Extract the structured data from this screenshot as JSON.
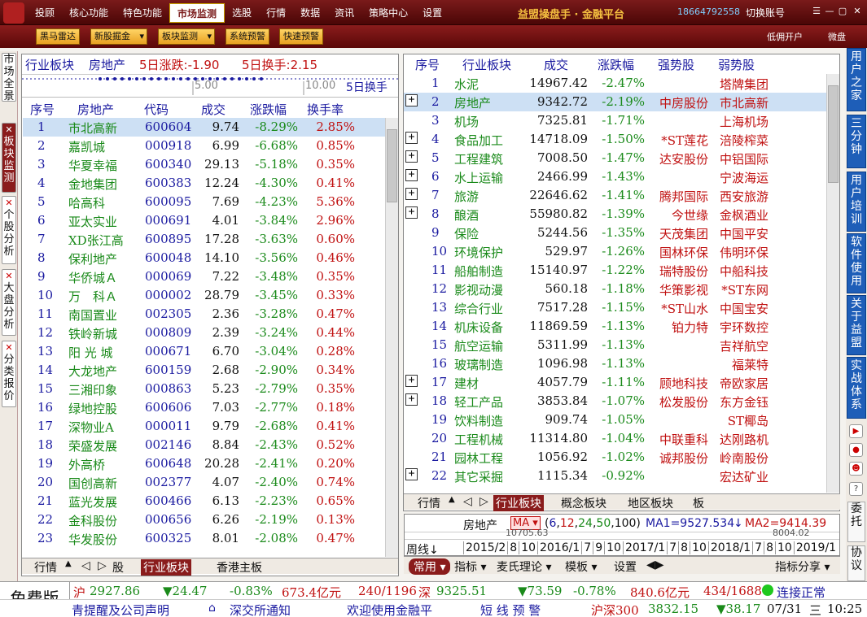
{
  "topbar": {
    "menu": [
      "投顾",
      "核心功能",
      "特色功能",
      "市场监测",
      "选股",
      "行情",
      "数据",
      "资讯",
      "策略中心",
      "设置"
    ],
    "active_menu": "市场监测",
    "app_title": "益盟操盘手 · 金融平台",
    "phone": "18664792558",
    "switch_account": "切换账号"
  },
  "toolbar": {
    "buttons": [
      "黑马雷达",
      "新股掘金",
      "板块监测",
      "系统预警",
      "快速预警"
    ],
    "dropdown_buttons": [
      "新股掘金",
      "板块监测"
    ],
    "right_links": [
      "低佣开户",
      "微盘"
    ]
  },
  "left_tabs": [
    {
      "label": "市场全景",
      "closable": false
    },
    {
      "label": "板块监测",
      "closable": true,
      "active": true
    },
    {
      "label": "个股分析",
      "closable": true
    },
    {
      "label": "大盘分析",
      "closable": true
    },
    {
      "label": "分类报价",
      "closable": true
    }
  ],
  "right_tabs": [
    "用户之家",
    "三分钟",
    "用户培训",
    "软件使用",
    "关于益盟",
    "实战体系"
  ],
  "right_text_buttons": [
    "委托",
    "协议"
  ],
  "left_panel": {
    "header": {
      "industry": "行业板块",
      "sector": "房地产",
      "rise5d": "5日涨跌:-1.90",
      "turnover5d": "5日换手:2.15"
    },
    "mini_chart": {
      "tick1": "5.00",
      "tick2": "10.00",
      "label": "5日换手"
    },
    "columns": [
      "序号",
      "房地产",
      "代码",
      "成交",
      "涨跌幅",
      "换手率"
    ],
    "rows": [
      [
        "1",
        "市北高新",
        "600604",
        "9.74",
        "-8.29%",
        "2.85%"
      ],
      [
        "2",
        "嘉凯城",
        "000918",
        "6.99",
        "-6.68%",
        "0.85%"
      ],
      [
        "3",
        "华夏幸福",
        "600340",
        "29.13",
        "-5.18%",
        "0.35%"
      ],
      [
        "4",
        "金地集团",
        "600383",
        "12.24",
        "-4.30%",
        "0.41%"
      ],
      [
        "5",
        "哈高科",
        "600095",
        "7.69",
        "-4.23%",
        "5.36%"
      ],
      [
        "6",
        "亚太实业",
        "000691",
        "4.01",
        "-3.84%",
        "2.96%"
      ],
      [
        "7",
        "XD张江高",
        "600895",
        "17.28",
        "-3.63%",
        "0.60%"
      ],
      [
        "8",
        "保利地产",
        "600048",
        "14.10",
        "-3.56%",
        "0.46%"
      ],
      [
        "9",
        "华侨城Ａ",
        "000069",
        "7.22",
        "-3.48%",
        "0.35%"
      ],
      [
        "10",
        "万　科Ａ",
        "000002",
        "28.79",
        "-3.45%",
        "0.33%"
      ],
      [
        "11",
        "南国置业",
        "002305",
        "2.36",
        "-3.28%",
        "0.47%"
      ],
      [
        "12",
        "铁岭新城",
        "000809",
        "2.39",
        "-3.24%",
        "0.44%"
      ],
      [
        "13",
        "阳 光 城",
        "000671",
        "6.70",
        "-3.04%",
        "0.28%"
      ],
      [
        "14",
        "大龙地产",
        "600159",
        "2.68",
        "-2.90%",
        "0.34%"
      ],
      [
        "15",
        "三湘印象",
        "000863",
        "5.23",
        "-2.79%",
        "0.35%"
      ],
      [
        "16",
        "绿地控股",
        "600606",
        "7.03",
        "-2.77%",
        "0.18%"
      ],
      [
        "17",
        "深物业A",
        "000011",
        "9.79",
        "-2.68%",
        "0.41%"
      ],
      [
        "18",
        "荣盛发展",
        "002146",
        "8.84",
        "-2.43%",
        "0.52%"
      ],
      [
        "19",
        "外高桥",
        "600648",
        "20.28",
        "-2.41%",
        "0.20%"
      ],
      [
        "20",
        "国创高新",
        "002377",
        "4.07",
        "-2.40%",
        "0.74%"
      ],
      [
        "21",
        "蓝光发展",
        "600466",
        "6.13",
        "-2.23%",
        "0.65%"
      ],
      [
        "22",
        "金科股份",
        "000656",
        "6.26",
        "-2.19%",
        "0.13%"
      ],
      [
        "23",
        "华发股份",
        "600325",
        "8.01",
        "-2.08%",
        "0.47%"
      ]
    ],
    "bottom_tabs": [
      "行情",
      "股",
      "行业板块",
      "香港主板"
    ]
  },
  "right_panel": {
    "columns": [
      "序号",
      "行业板块",
      "成交",
      "涨跌幅",
      "强势股",
      "弱势股"
    ],
    "rows": [
      {
        "cells": [
          "1",
          "水泥",
          "14967.42",
          "-2.47%",
          "",
          "塔牌集团"
        ],
        "plus": false
      },
      {
        "cells": [
          "2",
          "房地产",
          "9342.72",
          "-2.19%",
          "中房股份",
          "市北高新"
        ],
        "plus": true
      },
      {
        "cells": [
          "3",
          "机场",
          "7325.81",
          "-1.71%",
          "",
          "上海机场"
        ],
        "plus": false
      },
      {
        "cells": [
          "4",
          "食品加工",
          "14718.09",
          "-1.50%",
          "*ST莲花",
          "涪陵榨菜"
        ],
        "plus": true
      },
      {
        "cells": [
          "5",
          "工程建筑",
          "7008.50",
          "-1.47%",
          "达安股份",
          "中铝国际"
        ],
        "plus": true
      },
      {
        "cells": [
          "6",
          "水上运输",
          "2466.99",
          "-1.43%",
          "",
          "宁波海运"
        ],
        "plus": true
      },
      {
        "cells": [
          "7",
          "旅游",
          "22646.62",
          "-1.41%",
          "腾邦国际",
          "西安旅游"
        ],
        "plus": true
      },
      {
        "cells": [
          "8",
          "酿酒",
          "55980.82",
          "-1.39%",
          "今世缘",
          "金枫酒业"
        ],
        "plus": true
      },
      {
        "cells": [
          "9",
          "保险",
          "5244.56",
          "-1.35%",
          "天茂集团",
          "中国平安"
        ],
        "plus": false
      },
      {
        "cells": [
          "10",
          "环境保护",
          "529.97",
          "-1.26%",
          "国林环保",
          "伟明环保"
        ],
        "plus": false
      },
      {
        "cells": [
          "11",
          "船舶制造",
          "15140.97",
          "-1.22%",
          "瑞特股份",
          "中船科技"
        ],
        "plus": false
      },
      {
        "cells": [
          "12",
          "影视动漫",
          "560.18",
          "-1.18%",
          "华策影视",
          "*ST东网"
        ],
        "plus": false
      },
      {
        "cells": [
          "13",
          "综合行业",
          "7517.28",
          "-1.15%",
          "*ST山水",
          "中国宝安"
        ],
        "plus": false
      },
      {
        "cells": [
          "14",
          "机床设备",
          "11869.59",
          "-1.13%",
          "铂力特",
          "宇环数控"
        ],
        "plus": false
      },
      {
        "cells": [
          "15",
          "航空运输",
          "5311.99",
          "-1.13%",
          "",
          "吉祥航空"
        ],
        "plus": false
      },
      {
        "cells": [
          "16",
          "玻璃制造",
          "1096.98",
          "-1.13%",
          "",
          "福莱特"
        ],
        "plus": false
      },
      {
        "cells": [
          "17",
          "建材",
          "4057.79",
          "-1.11%",
          "顾地科技",
          "帝欧家居"
        ],
        "plus": true
      },
      {
        "cells": [
          "18",
          "轻工产品",
          "3853.84",
          "-1.07%",
          "松发股份",
          "东方金钰"
        ],
        "plus": true
      },
      {
        "cells": [
          "19",
          "饮料制造",
          "909.74",
          "-1.05%",
          "",
          "ST椰岛"
        ],
        "plus": false
      },
      {
        "cells": [
          "20",
          "工程机械",
          "11314.80",
          "-1.04%",
          "中联重科",
          "达刚路机"
        ],
        "plus": false
      },
      {
        "cells": [
          "21",
          "园林工程",
          "1056.92",
          "-1.02%",
          "诚邦股份",
          "岭南股份"
        ],
        "plus": false
      },
      {
        "cells": [
          "22",
          "其它采掘",
          "1115.34",
          "-0.92%",
          "",
          "宏达矿业"
        ],
        "plus": true
      }
    ],
    "bottom_tabs": [
      "行情",
      "行业板块",
      "概念板块",
      "地区板块",
      "板"
    ]
  },
  "kline": {
    "name": "房地产",
    "ma_label": "MA",
    "params": [
      "6",
      "12",
      "24",
      "50",
      "100"
    ],
    "ma1": "MA1=9527.534",
    "ma2": "MA2=9414.39",
    "overlay1": "10705.63",
    "overlay2": "8004.02",
    "period": "周线",
    "dates": [
      "2015/2",
      "8",
      "10",
      "2016/1",
      "7",
      "9",
      "10",
      "2017/1",
      "7",
      "8",
      "10",
      "2018/1",
      "7",
      "8",
      "10",
      "2019/1",
      "7"
    ],
    "tools": [
      "常用",
      "指标",
      "麦氏理论",
      "模板",
      "设置",
      "指标分享"
    ]
  },
  "status": {
    "free": "免费版",
    "sh_label": "沪",
    "sh_value": "2927.86",
    "sh_change": "▼24.47",
    "sh_pct": "-0.83%",
    "sh_amount": "673.4亿元",
    "sh_count": "240/1196",
    "sz_label": "深",
    "sz_value": "9325.51",
    "sz_change": "▼73.59",
    "sz_pct": "-0.78%",
    "sz_amount": "840.6亿元",
    "sz_count": "434/1688",
    "connection": "连接正常",
    "notice1": "青提醒及公司声明",
    "notice2": "深交所通知",
    "notice3": "欢迎使用金融平",
    "alert": "短 线 预 警",
    "hs300_label": "沪深300",
    "hs300_value": "3832.15",
    "hs300_change": "▼38.17",
    "date": "07/31",
    "weekday": "三",
    "time": "10:25"
  },
  "colors": {
    "brand": "#7a1a1a",
    "up": "#c01010",
    "down": "#1a8a1a",
    "header": "#1a1aa0",
    "selected": "#cde0f4"
  }
}
